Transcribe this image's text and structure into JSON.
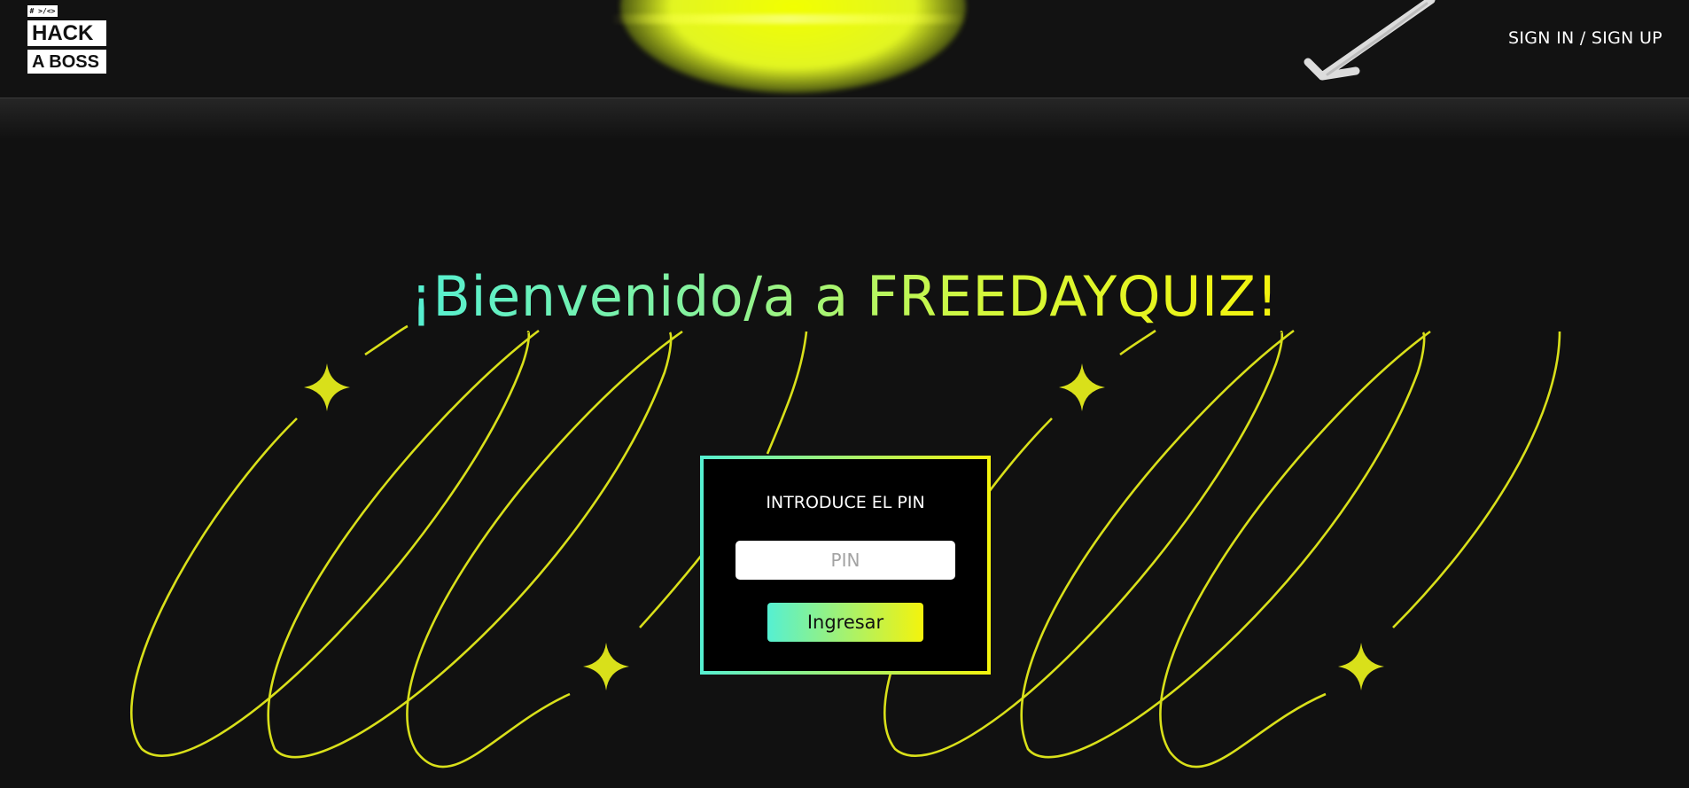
{
  "logo": {
    "tag": "# >/<>",
    "line1": "HACK",
    "line2": "A BOSS"
  },
  "header": {
    "auth_link": "SIGN IN / SIGN UP"
  },
  "hero": {
    "title": "¡Bienvenido/a a FREEDAYQUIZ!"
  },
  "pin_form": {
    "title": "INTRODUCE EL PIN",
    "placeholder": "PIN",
    "value": "",
    "submit_label": "Ingresar"
  },
  "colors": {
    "background": "#111111",
    "accent_start": "#55f0d2",
    "accent_end": "#f4f30c",
    "decoration": "#d9e01a"
  }
}
